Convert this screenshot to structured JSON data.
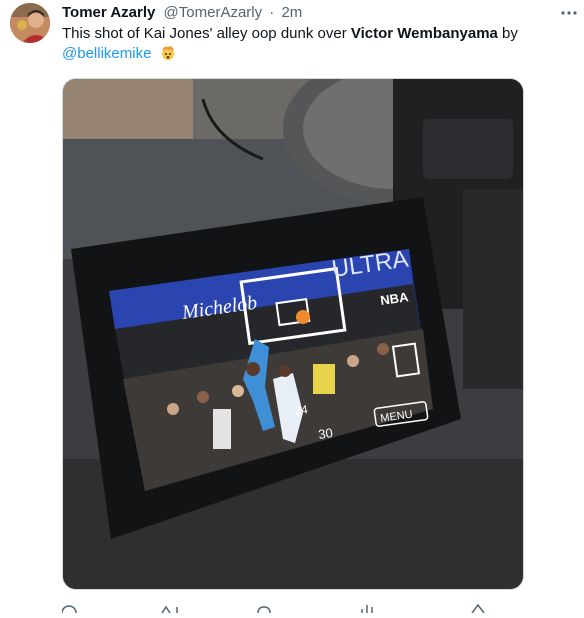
{
  "tweet": {
    "author_name": "Tomer Azarly",
    "author_handle": "@TomerAzarly",
    "separator": "·",
    "time": "2m",
    "text_part1": "This shot of Kai Jones' alley oop dunk over ",
    "text_bold": "Victor Wembanyama",
    "text_part2": " by",
    "mention": "@bellikemike",
    "emoji": "exploding-head-emoji"
  },
  "media": {
    "screen_banner_text": "ULTRA",
    "screen_brand_text": "Michelob",
    "screen_sponsor_text": "NBA",
    "jersey_left": "24",
    "jersey_right": "30",
    "menu_label": "MENU"
  },
  "icons": {
    "more": "more-dots-icon",
    "reply": "reply-icon",
    "retweet": "retweet-icon",
    "like": "heart-icon",
    "views": "views-icon",
    "share": "share-icon"
  },
  "colors": {
    "mention": "#1d9bf0",
    "text": "#0f1419",
    "muted": "#536471"
  }
}
